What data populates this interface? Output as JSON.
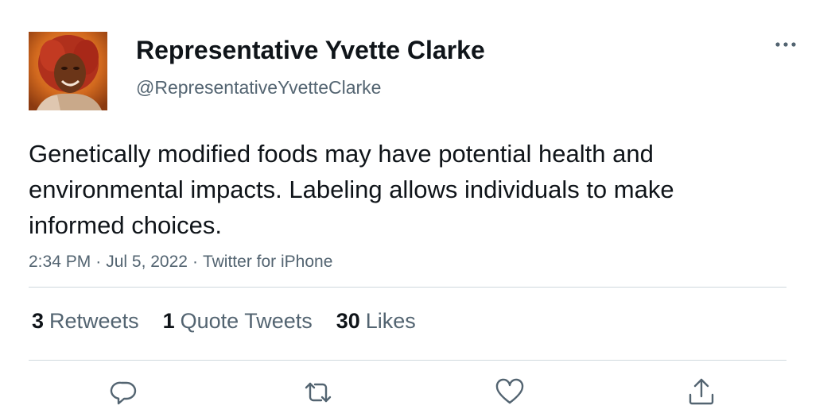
{
  "author": {
    "display_name": "Representative Yvette Clarke",
    "handle": "@RepresentativeYvetteClarke"
  },
  "tweet": {
    "text": "Genetically modified foods may have potential health and environmental impacts. Labeling allows individuals to make informed choices.",
    "time": "2:34 PM",
    "date": "Jul 5, 2022",
    "source": "Twitter for iPhone",
    "separator": "·"
  },
  "stats": {
    "retweets_count": "3",
    "retweets_label": "Retweets",
    "quote_tweets_count": "1",
    "quote_tweets_label": "Quote Tweets",
    "likes_count": "30",
    "likes_label": "Likes"
  },
  "icons": {
    "more": "more-horizontal-icon",
    "reply": "reply-icon",
    "retweet": "retweet-icon",
    "like": "heart-icon",
    "share": "share-icon"
  },
  "colors": {
    "primary_text": "#0f1419",
    "secondary_text": "#536471",
    "divider": "#cfd9de"
  }
}
